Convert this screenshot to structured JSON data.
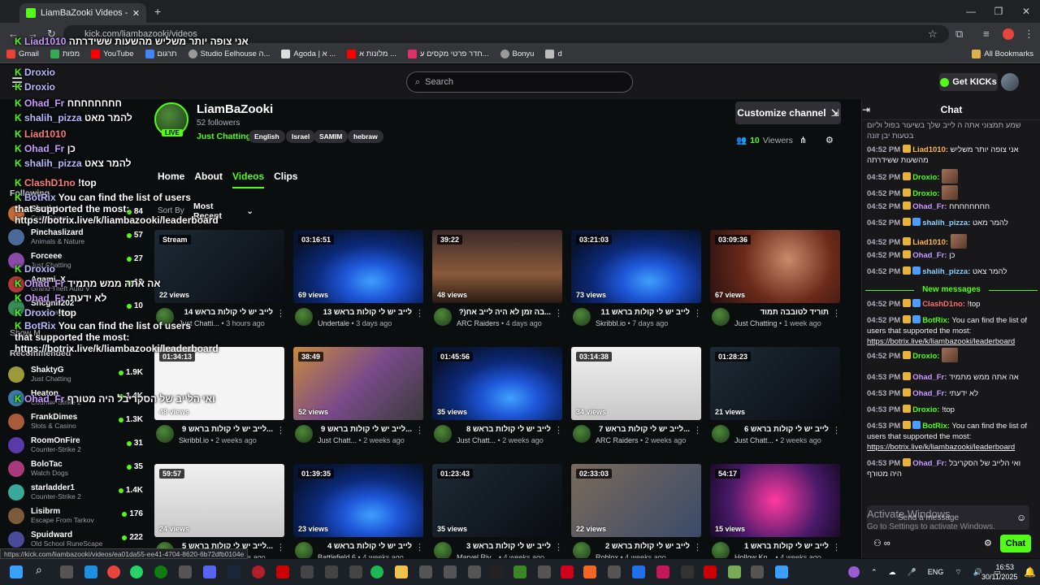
{
  "browser": {
    "tab_title": "LiamBaZooki Videos - Watch Or",
    "url": "kick.com/liambazooki/videos",
    "bookmarks": [
      "Gmail",
      "מפות",
      "YouTube",
      "תרגום",
      "Studio Eelhouse ה...",
      "Agoda | א ...",
      "מלונות א ...",
      "חדר פרטי מקסים ע...",
      "Bonyu",
      "d"
    ],
    "all_bookmarks": "All Bookmarks",
    "status_url": "https://kick.com/liambazooki/videos/ea01da55-ee41-4704-8620-6b72dfb0104e"
  },
  "topbar": {
    "search_placeholder": "Search",
    "get_kicks": "Get KICKs"
  },
  "sidebar": {
    "followed_title": "Following",
    "recommended_title": "Recommended",
    "show_more": "Show M",
    "followed": [
      {
        "name": "Shotist",
        "game": "Crab Game",
        "count": "84"
      },
      {
        "name": "Pinchaslizard",
        "game": "Animals & Nature",
        "count": "57"
      },
      {
        "name": "Forceee",
        "game": "Just Chatting",
        "count": "27"
      },
      {
        "name": "Agami_X",
        "game": "Grand Theft Auto V",
        "count": "12"
      },
      {
        "name": "Shcgnif202",
        "game": "Just Chatting",
        "count": "10"
      }
    ],
    "recommended": [
      {
        "name": "ShaktyG",
        "game": "Just Chatting",
        "count": "1.9K"
      },
      {
        "name": "Heaton",
        "game": "Counter-Strike 2",
        "count": "1.4K"
      },
      {
        "name": "FrankDimes",
        "game": "Slots & Casino",
        "count": "1.3K"
      },
      {
        "name": "RoomOnFire",
        "game": "Counter-Strike 2",
        "count": "31"
      },
      {
        "name": "BoloTac",
        "game": "Watch Dogs",
        "count": "35"
      },
      {
        "name": "starladder1",
        "game": "Counter-Strike 2",
        "count": "1.4K"
      },
      {
        "name": "Lisibrm",
        "game": "Escape From Tarkov",
        "count": "176"
      },
      {
        "name": "Spuidward",
        "game": "Old School RuneScape",
        "count": "222"
      }
    ]
  },
  "overlay_chat": [
    {
      "user": "Liad1010",
      "text": "אני צופה יותר משליש מהשעות ששידרתה"
    },
    {
      "user": "Droxio",
      "text": ""
    },
    {
      "user": "Droxio",
      "text": ""
    },
    {
      "user": "Ohad_Fr",
      "text": "חחחחחחחח"
    },
    {
      "user": "shalih_pizza",
      "text": "להמר מאט"
    },
    {
      "user": "Liad1010",
      "text": ""
    },
    {
      "user": "Ohad_Fr",
      "text": "כן"
    },
    {
      "user": "shalih_pizza",
      "text": "להמר צאט"
    },
    {
      "user": "ClashD1no",
      "text": "!top"
    },
    {
      "user": "BotRix",
      "text": "You can find the list of users that supported the most: https://botrix.live/k/liambazooki/leaderboard"
    },
    {
      "user": "Droxio",
      "text": ""
    },
    {
      "user": "Ohad_Fr",
      "text": "אה אתה ממש מתמיד"
    },
    {
      "user": "Ohad_Fr",
      "text": "לא ידעתי"
    },
    {
      "user": "Droxio",
      "text": "!top"
    },
    {
      "user": "BotRix",
      "text": "You can find the list of users that supported the most: https://botrix.live/k/liambazooki/leaderboard"
    },
    {
      "user": "Ohad_Fr",
      "text": "ואי הלייב של הסקריבל היה מטורף"
    }
  ],
  "channel": {
    "name": "LiamBaZooki",
    "followers": "52 followers",
    "category": "Just Chatting",
    "tags": [
      "English",
      "Israel",
      "SAMIM",
      "hebraw"
    ],
    "live_badge": "LIVE",
    "customize": "Customize channel",
    "viewers_count": "10",
    "viewers_label": "Viewers",
    "tabs": [
      "Home",
      "About",
      "Videos",
      "Clips"
    ],
    "active_tab": "Videos",
    "sort_label": "Sort By",
    "sort_value": "Most Recent"
  },
  "videos": [
    {
      "dur": "Stream",
      "views": "22 views",
      "title": "לייב יש לי קולות בראש 14",
      "cat": "Just Chatti...",
      "ago": "3 hours ago",
      "thumb": "dark"
    },
    {
      "dur": "03:16:51",
      "views": "69 views",
      "title": "לייב יש לי קולות בראש 13",
      "cat": "Undertale",
      "ago": "3 days ago",
      "thumb": "win11"
    },
    {
      "dur": "39:22",
      "views": "48 views",
      "title": "...בה זמן לא היה לייב אח(?",
      "cat": "ARC Raiders",
      "ago": "4 days ago",
      "thumb": "arc"
    },
    {
      "dur": "03:21:03",
      "views": "73 views",
      "title": "לייב יש לי קולות בראש 11",
      "cat": "Skribbl.io",
      "ago": "7 days ago",
      "thumb": "win11"
    },
    {
      "dur": "03:09:36",
      "views": "67 views",
      "title": "תוריד לטובבה תמוד",
      "cat": "Just Chatting",
      "ago": "1 week ago",
      "thumb": "red"
    },
    {
      "dur": "01:34:13",
      "views": "48 views",
      "title": "...לייב יש לי קולות בראש 9",
      "cat": "Skribbl.io",
      "ago": "2 weeks ago",
      "thumb": "draw"
    },
    {
      "dur": "38:49",
      "views": "52 views",
      "title": "...לייב יש לי קולות בראש 9",
      "cat": "Just Chatt...",
      "ago": "2 weeks ago",
      "thumb": "grid"
    },
    {
      "dur": "01:45:56",
      "views": "35 views",
      "title": "לייב יש לי קולות בראש 8",
      "cat": "Just Chatt...",
      "ago": "2 weeks ago",
      "thumb": "win11"
    },
    {
      "dur": "03:14:38",
      "views": "34 views",
      "title": "...לייב יש לי קולות בראש 7",
      "cat": "ARC Raiders",
      "ago": "2 weeks ago",
      "thumb": "white"
    },
    {
      "dur": "01:28:23",
      "views": "21 views",
      "title": "לייב יש לי קולות בראש 6",
      "cat": "Just Chatt...",
      "ago": "2 weeks ago",
      "thumb": "dark"
    },
    {
      "dur": "59:57",
      "views": "24 views",
      "title": "...לייב יש לי קולות בראש 5",
      "cat": "Just Chatt...",
      "ago": "3 weeks ago",
      "thumb": "white"
    },
    {
      "dur": "01:39:35",
      "views": "23 views",
      "title": "לייב יש לי קולות בראש 4",
      "cat": "Battlefield 6",
      "ago": "4 weeks ago",
      "thumb": "win11"
    },
    {
      "dur": "01:23:43",
      "views": "35 views",
      "title": "לייב יש לי קולות בראש 3",
      "cat": "Marvel Riv...",
      "ago": "4 weeks ago",
      "thumb": "dark"
    },
    {
      "dur": "02:33:03",
      "views": "22 views",
      "title": "לייב יש לי קולות בראש 2",
      "cat": "Roblox",
      "ago": "4 weeks ago",
      "thumb": "room"
    },
    {
      "dur": "54:17",
      "views": "15 views",
      "title": "לייב יש לי קולות בראש 1",
      "cat": "Hollow Kn...",
      "ago": "4 weeks ago",
      "thumb": "pink"
    }
  ],
  "chat": {
    "title": "Chat",
    "new_messages": "New messages",
    "messages": [
      {
        "time": "",
        "user": "",
        "text": "שמע תמצוני אתה ה לייב שלך בשיעור בפול וליום בטעות יבן זונה"
      },
      {
        "time": "04:52 PM",
        "user": "Liad1010:",
        "text": "אני צופה יותר משליש מהשעות ששידרתה"
      },
      {
        "time": "04:52 PM",
        "user": "Droxio:",
        "text": ""
      },
      {
        "time": "04:52 PM",
        "user": "Droxio:",
        "text": ""
      },
      {
        "time": "04:52 PM",
        "user": "Ohad_Fr:",
        "text": "חחחחחחחח"
      },
      {
        "time": "04:52 PM",
        "user": "shalih_pizza:",
        "text": "להמר מאט"
      },
      {
        "time": "04:52 PM",
        "user": "Liad1010:",
        "text": ""
      },
      {
        "time": "04:52 PM",
        "user": "Ohad_Fr:",
        "text": "כן"
      },
      {
        "time": "04:52 PM",
        "user": "shalih_pizza:",
        "text": "להמר צאט"
      },
      {
        "time": "04:52 PM",
        "user": "ClashD1no:",
        "text": "!top"
      },
      {
        "time": "04:52 PM",
        "user": "BotRix:",
        "text": "You can find the list of users that supported the most:",
        "link": "https://botrix.live/k/liambazooki/leaderboard"
      },
      {
        "time": "04:52 PM",
        "user": "Droxio:",
        "text": ""
      },
      {
        "time": "04:53 PM",
        "user": "Ohad_Fr:",
        "text": "אה אתה ממש מתמיד"
      },
      {
        "time": "04:53 PM",
        "user": "Ohad_Fr:",
        "text": "לא ידעתי"
      },
      {
        "time": "04:53 PM",
        "user": "Droxio:",
        "text": "!top"
      },
      {
        "time": "04:53 PM",
        "user": "BotRix:",
        "text": "You can find the list of users that supported the most:",
        "link": "https://botrix.live/k/liambazooki/leaderboard"
      },
      {
        "time": "04:53 PM",
        "user": "Ohad_Fr:",
        "text": "ואי הלייב של הסקריבל היה מטורף"
      }
    ],
    "input_placeholder": "Send a message",
    "send": "Chat",
    "activate_title": "Activate Windows",
    "activate_sub": "Go to Settings to activate Windows."
  },
  "taskbar": {
    "lang": "ENG",
    "time": "16:53",
    "date": "30/11/2025"
  },
  "colors": {
    "accent": "#53fc18",
    "bg": "#0b0e0f",
    "panel": "#18181b"
  }
}
